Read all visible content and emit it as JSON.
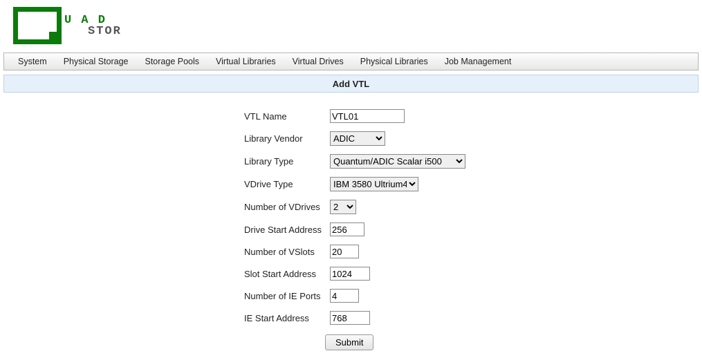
{
  "logo": {
    "top": "U A D",
    "bottom": "STOR"
  },
  "nav": {
    "items": [
      "System",
      "Physical Storage",
      "Storage Pools",
      "Virtual Libraries",
      "Virtual Drives",
      "Physical Libraries",
      "Job Management"
    ]
  },
  "title": "Add VTL",
  "form": {
    "vtl_name": {
      "label": "VTL Name",
      "value": "VTL01"
    },
    "library_vendor": {
      "label": "Library Vendor",
      "value": "ADIC"
    },
    "library_type": {
      "label": "Library Type",
      "value": "Quantum/ADIC Scalar i500"
    },
    "vdrive_type": {
      "label": "VDrive Type",
      "value": "IBM 3580 Ultrium4"
    },
    "num_vdrives": {
      "label": "Number of VDrives",
      "value": "2"
    },
    "drive_start_addr": {
      "label": "Drive Start Address",
      "value": "256"
    },
    "num_vslots": {
      "label": "Number of VSlots",
      "value": "20"
    },
    "slot_start_addr": {
      "label": "Slot Start Address",
      "value": "1024"
    },
    "num_ie_ports": {
      "label": "Number of IE Ports",
      "value": "4"
    },
    "ie_start_addr": {
      "label": "IE Start Address",
      "value": "768"
    },
    "submit_label": "Submit"
  }
}
